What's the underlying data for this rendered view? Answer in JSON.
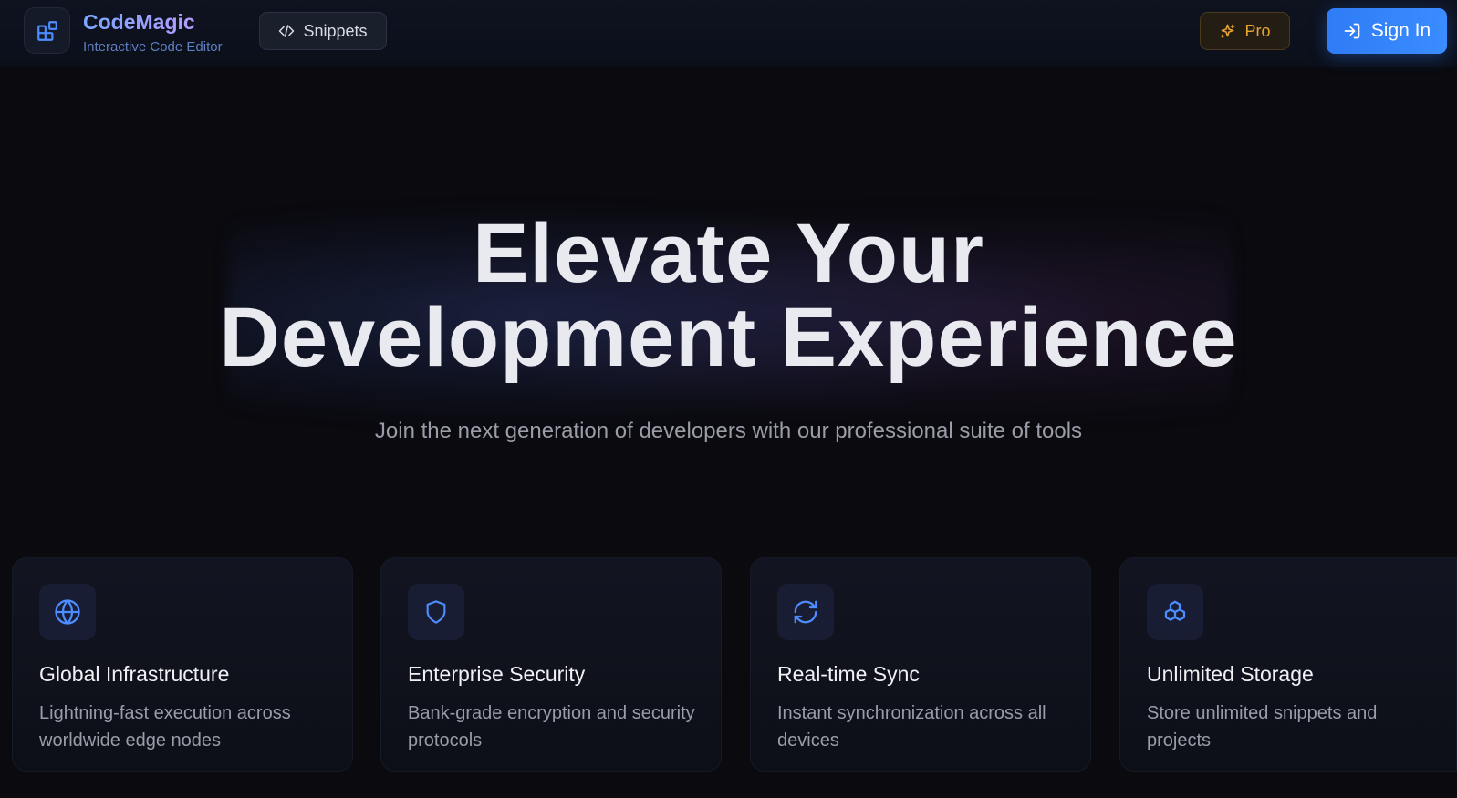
{
  "header": {
    "brand_name": "CodeMagic",
    "brand_subtitle": "Interactive Code Editor",
    "snippets_label": "Snippets",
    "pro_label": "Pro",
    "sign_in_label": "Sign In"
  },
  "hero": {
    "title_line1": "Elevate Your",
    "title_line2": "Development Experience",
    "subtitle": "Join the next generation of developers with our professional suite of tools"
  },
  "features": [
    {
      "icon": "globe-icon",
      "title": "Global Infrastructure",
      "description": "Lightning-fast execution across worldwide edge nodes"
    },
    {
      "icon": "shield-icon",
      "title": "Enterprise Security",
      "description": "Bank-grade encryption and security protocols"
    },
    {
      "icon": "refresh-icon",
      "title": "Real-time Sync",
      "description": "Instant synchronization across all devices"
    },
    {
      "icon": "boxes-icon",
      "title": "Unlimited Storage",
      "description": "Store unlimited snippets and projects"
    }
  ],
  "colors": {
    "accent_blue": "#3a8cff",
    "pro_gold": "#e6a533",
    "background": "#0a0a0f"
  }
}
